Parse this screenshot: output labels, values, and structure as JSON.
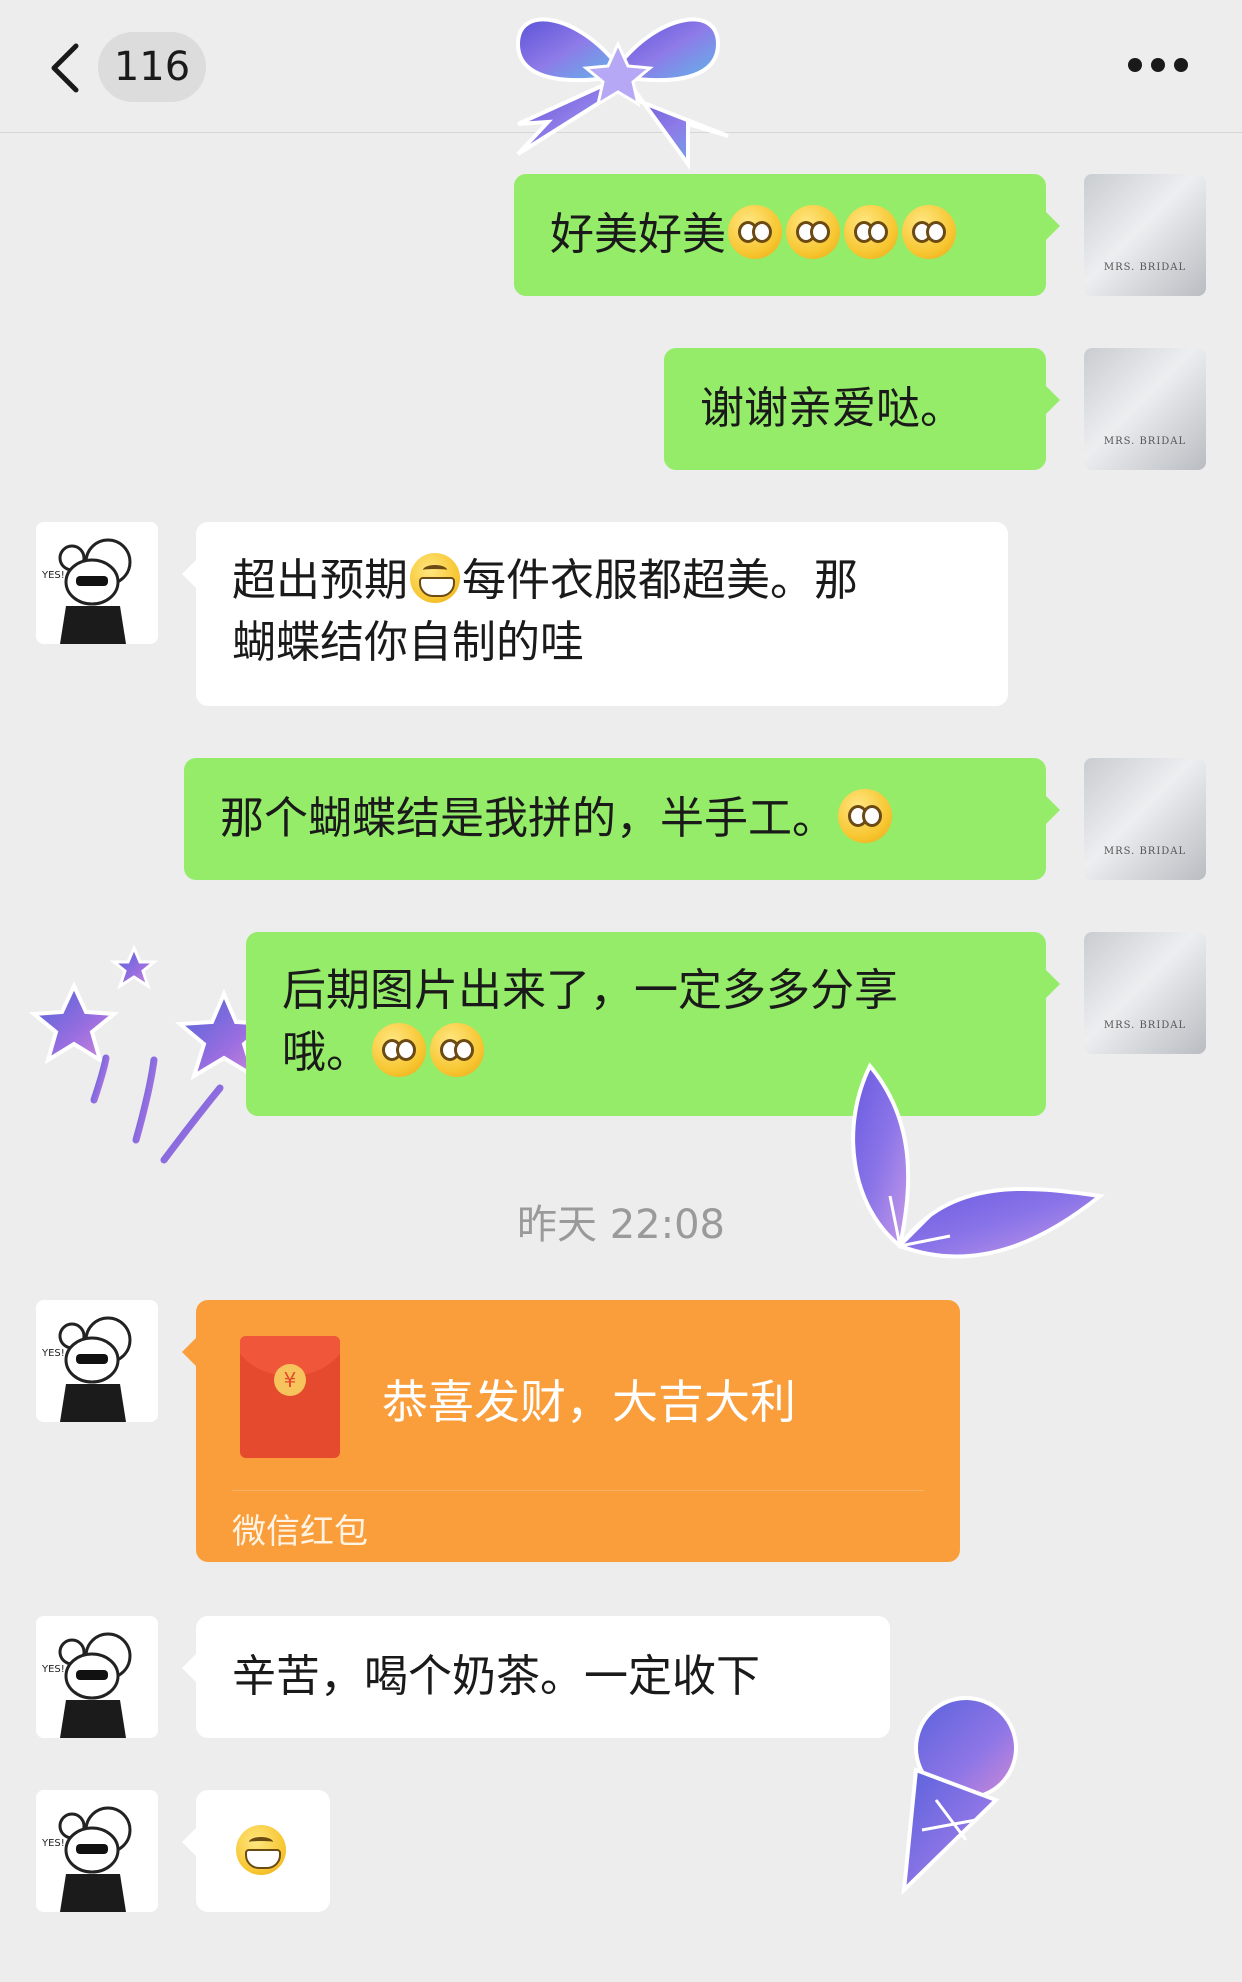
{
  "header": {
    "unread_count": "116"
  },
  "self_avatar": {
    "brand_text": "MRS. BRIDAL"
  },
  "messages": [
    {
      "side": "self",
      "text": "好美好美"
    },
    {
      "side": "self",
      "text": "谢谢亲爱哒。"
    },
    {
      "side": "friend",
      "text_line1a": "超出预期",
      "text_line1b": "每件衣服都超美。那",
      "text_line2": "蝴蝶结你自制的哇"
    },
    {
      "side": "self",
      "text": "那个蝴蝶结是我拼的，半手工。"
    },
    {
      "side": "self",
      "text_line1": "后期图片出来了，一定多多分享",
      "text_line2": "哦。"
    }
  ],
  "timestamp": "昨天 22:08",
  "red_packet": {
    "title": "恭喜发财，大吉大利",
    "label": "微信红包",
    "coin_symbol": "¥"
  },
  "messages_after": [
    {
      "side": "friend",
      "text": "辛苦，喝个奶茶。一定收下"
    },
    {
      "side": "friend",
      "emoji_only": true
    }
  ],
  "colors": {
    "bubble_self": "#95ec69",
    "bubble_friend": "#ffffff",
    "red_packet": "#fa9d3b",
    "background": "#ededed"
  },
  "icons": [
    "back-chevron-icon",
    "more-dots-icon",
    "bow-sticker",
    "stars-sticker",
    "leaf-sticker",
    "icecream-sticker"
  ]
}
